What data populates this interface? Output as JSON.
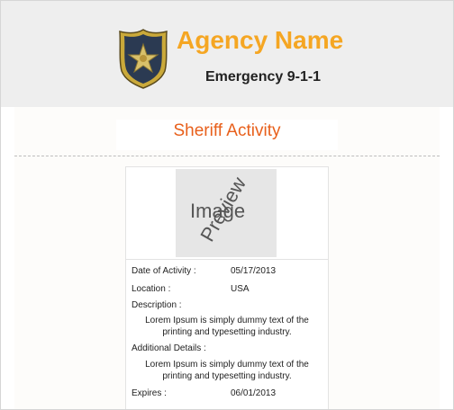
{
  "header": {
    "agency_name": "Agency Name",
    "subtitle": "Emergency 9-1-1",
    "badge_icon": "sheriff-badge-icon"
  },
  "page": {
    "title": "Sheriff Activity"
  },
  "card": {
    "image_preview": {
      "word1": "Image",
      "word2": "Preview"
    },
    "fields": {
      "date_label": "Date of Activity :",
      "date_value": "05/17/2013",
      "location_label": "Location :",
      "location_value": "USA",
      "description_label": "Description :",
      "description_line1": "Lorem Ipsum is simply dummy text of the",
      "description_line2": "printing and typesetting industry.",
      "additional_label": "Additional Details :",
      "additional_line1": "Lorem Ipsum is simply dummy text of the",
      "additional_line2": "printing and typesetting industry.",
      "expires_label": "Expires :",
      "expires_value": "06/01/2013"
    }
  },
  "colors": {
    "agency_name": "#f5a623",
    "title": "#e8601c",
    "header_bg": "#eeeeee"
  }
}
